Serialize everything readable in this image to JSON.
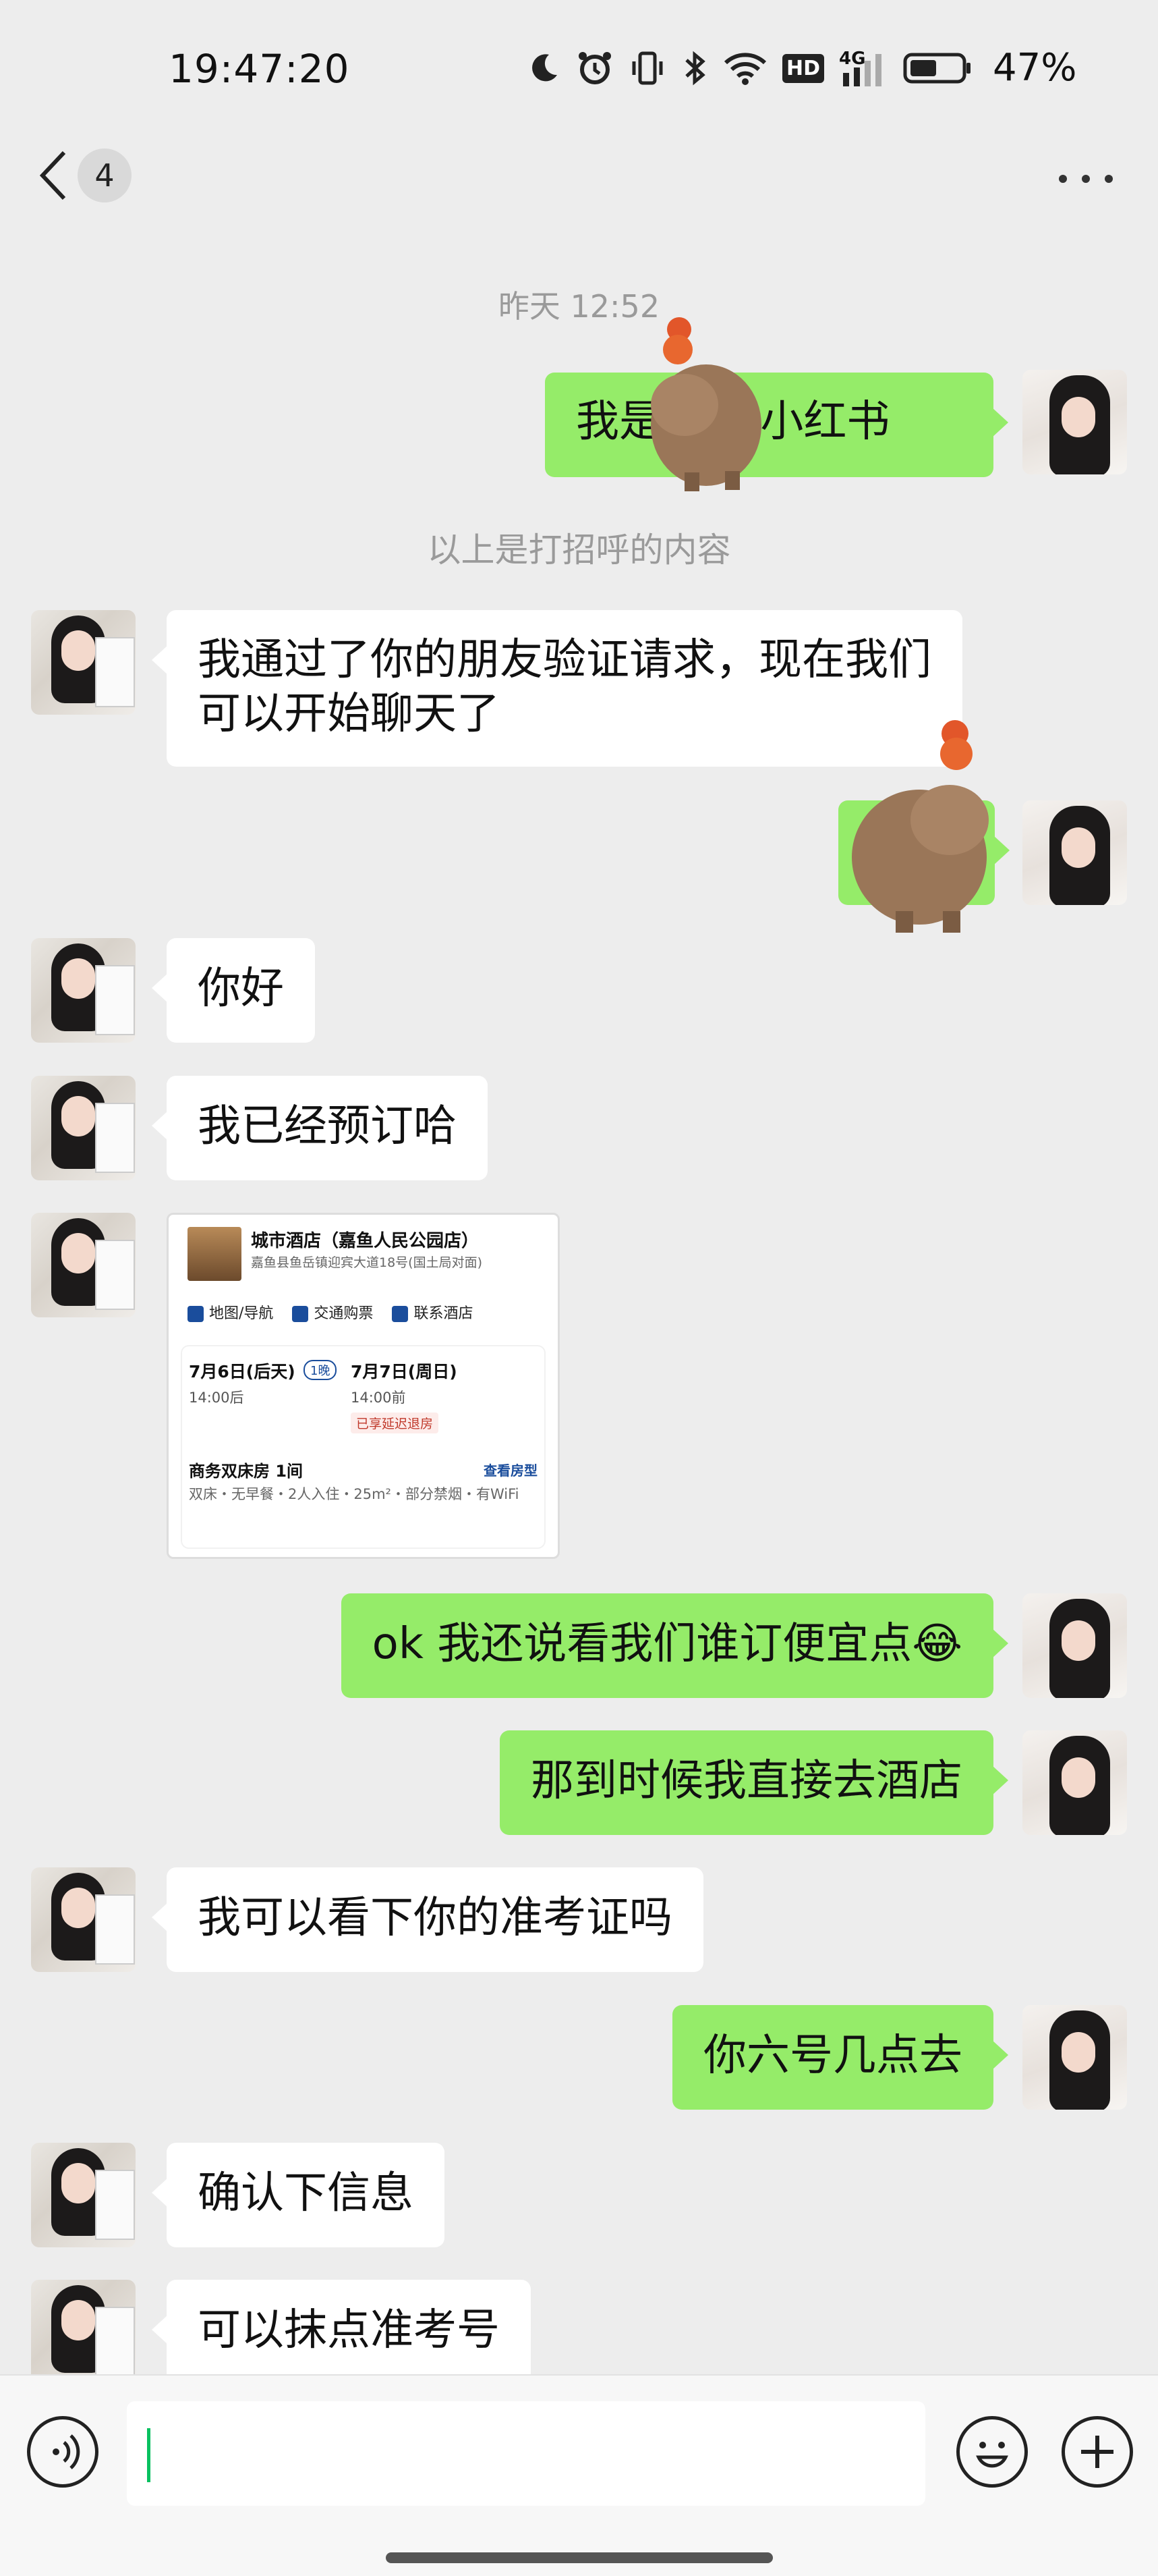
{
  "status_bar": {
    "time": "19:47:20",
    "battery": "47%",
    "network": "4G",
    "hd": "HD"
  },
  "header": {
    "unread_count": "4"
  },
  "chat": {
    "timestamp": "昨天 12:52",
    "system_note": "以上是打招呼的内容",
    "messages": [
      {
        "side": "out",
        "text": "我是          hyr,小红书"
      },
      {
        "side": "in",
        "text": "我通过了你的朋友验证请求，现在我们可以开始聊天了"
      },
      {
        "side": "in",
        "text": "你好"
      },
      {
        "side": "in",
        "text": "我已经预订哈"
      },
      {
        "side": "out",
        "text": "ok 我还说看我们谁订便宜点😂"
      },
      {
        "side": "out",
        "text": "那到时候我直接去酒店"
      },
      {
        "side": "in",
        "text": "我可以看下你的准考证吗"
      },
      {
        "side": "out",
        "text": "你六号几点去"
      },
      {
        "side": "in",
        "text": "确认下信息"
      },
      {
        "side": "in",
        "text": "可以抹点准考号"
      }
    ],
    "hotel_card": {
      "name": "城市酒店（嘉鱼人民公园店）",
      "address": "嘉鱼县鱼岳镇迎宾大道18号(国土局对面)",
      "actions": [
        "地图/导航",
        "交通购票",
        "联系酒店"
      ],
      "checkin_date": "7月6日(后天)",
      "nights": "1晚",
      "checkout_date": "7月7日(周日)",
      "checkin_time": "14:00后",
      "checkout_time": "14:00前",
      "refund_badge": "已享延迟退房",
      "room": "商务双床房 1间",
      "view_room": "查看房型",
      "room_desc": "双床・无早餐・2人入住・25m²・部分禁烟・有WiFi"
    }
  },
  "colors": {
    "background": "#ededed",
    "outgoing_bubble": "#95ec69",
    "incoming_bubble": "#ffffff",
    "cursor": "#07c160"
  },
  "icons": [
    "moon-icon",
    "alarm-icon",
    "vibrate-icon",
    "bluetooth-icon",
    "wifi-icon",
    "signal-icon",
    "battery-icon",
    "back-chevron-icon",
    "more-icon",
    "voice-icon",
    "emoji-icon",
    "plus-icon"
  ]
}
